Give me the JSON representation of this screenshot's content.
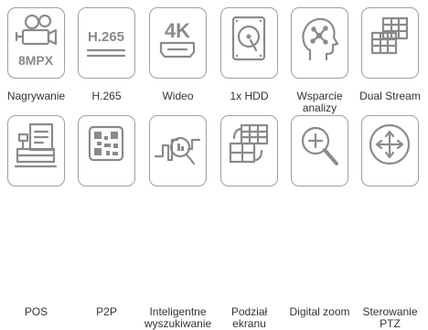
{
  "features": {
    "row1": [
      {
        "label": "Nagrywanie",
        "icon": "video-camera-icon",
        "badge": "8MPX"
      },
      {
        "label": "H.265",
        "icon": "h265-codec-icon",
        "badge": "H.265"
      },
      {
        "label": "Wideo",
        "icon": "4k-hdmi-icon",
        "badge": "4K"
      },
      {
        "label": "1x HDD",
        "icon": "hard-disk-icon"
      },
      {
        "label": "Wsparcie analizy",
        "icon": "head-analytics-icon"
      },
      {
        "label": "Dual Stream",
        "icon": "dual-stream-icon"
      }
    ],
    "row2": [
      {
        "label": "POS",
        "icon": "pos-terminal-icon"
      },
      {
        "label": "P2P",
        "icon": "qr-code-icon"
      },
      {
        "label": "Inteligentne wyszukiwanie",
        "icon": "smart-search-icon"
      },
      {
        "label": "Podział ekranu",
        "icon": "split-screen-icon"
      },
      {
        "label": "Digital zoom",
        "icon": "zoom-icon"
      },
      {
        "label": "Sterowanie PTZ",
        "icon": "ptz-arrows-icon"
      }
    ]
  },
  "colors": {
    "icon": "#8a8a8a",
    "border": "#9e9e9e",
    "text": "#333333"
  }
}
